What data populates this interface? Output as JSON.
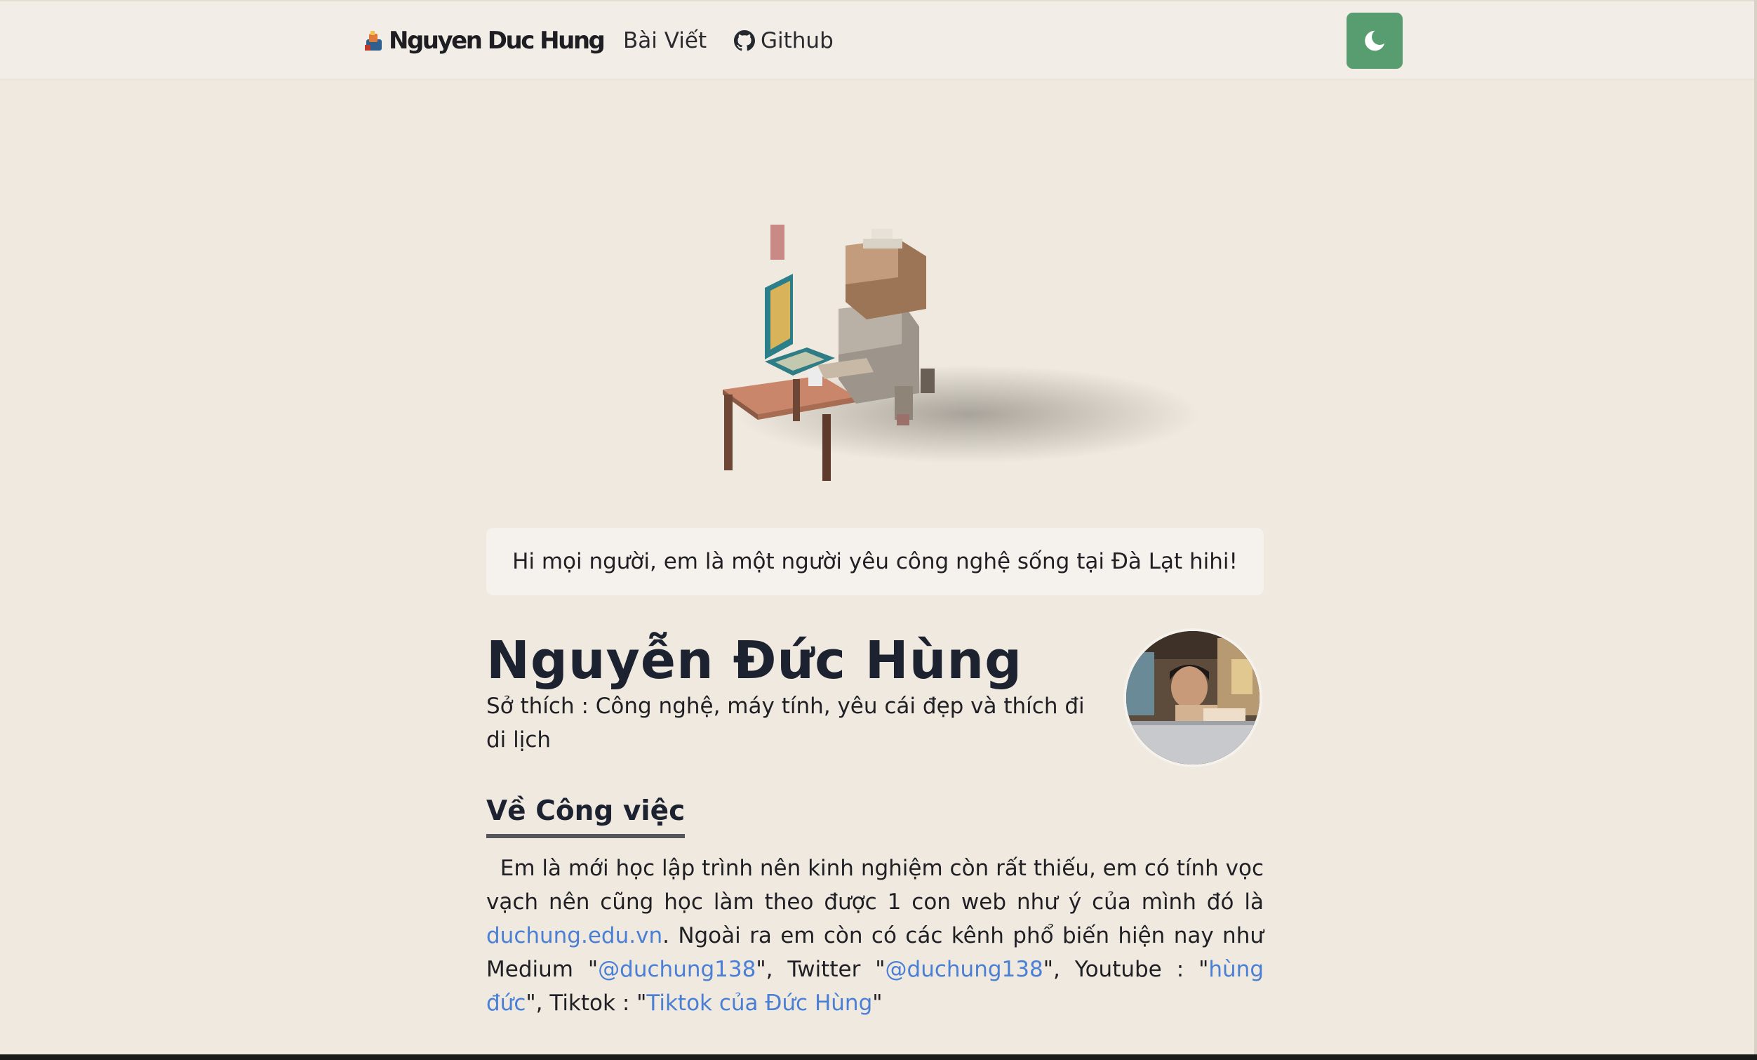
{
  "nav": {
    "brand": "Nguyen Duc Hung",
    "links": [
      {
        "label": "Bài Viết"
      },
      {
        "label": "Github"
      }
    ],
    "theme_toggle_icon": "moon-icon"
  },
  "hero": {
    "illustration": "voxel-character-at-computer-desk",
    "greeting": "Hi mọi người, em là một người yêu công nghệ sống tại Đà Lạt hihi!"
  },
  "profile": {
    "name": "Nguyễn Đức Hùng",
    "hobby": "Sở thích : Công nghệ, máy tính, yêu cái đẹp và thích đi di lịch"
  },
  "work": {
    "heading": "Về Công việc",
    "p1": "Em là mới học lập trình nên kinh nghiệm còn rất thiếu, em có tính vọc vạch nên cũng học làm theo được 1 con web như ý của mình đó là ",
    "link_site": "duchung.edu.vn",
    "p2": ". Ngoài ra em còn có các kênh phổ biến hiện nay như Medium \"",
    "link_medium": "@duchung138",
    "p3": "\", Twitter \"",
    "link_twitter": "@duchung138",
    "p4": "\", Youtube : \"",
    "link_youtube": "hùng đức",
    "p5": "\", Tiktok : \"",
    "link_tiktok": "Tiktok của Đức Hùng",
    "p6": "\""
  },
  "colors": {
    "background": "#efe9df",
    "navbar": "#f2eee7",
    "accent_button": "#589d6f",
    "link": "#4a7fd6"
  }
}
